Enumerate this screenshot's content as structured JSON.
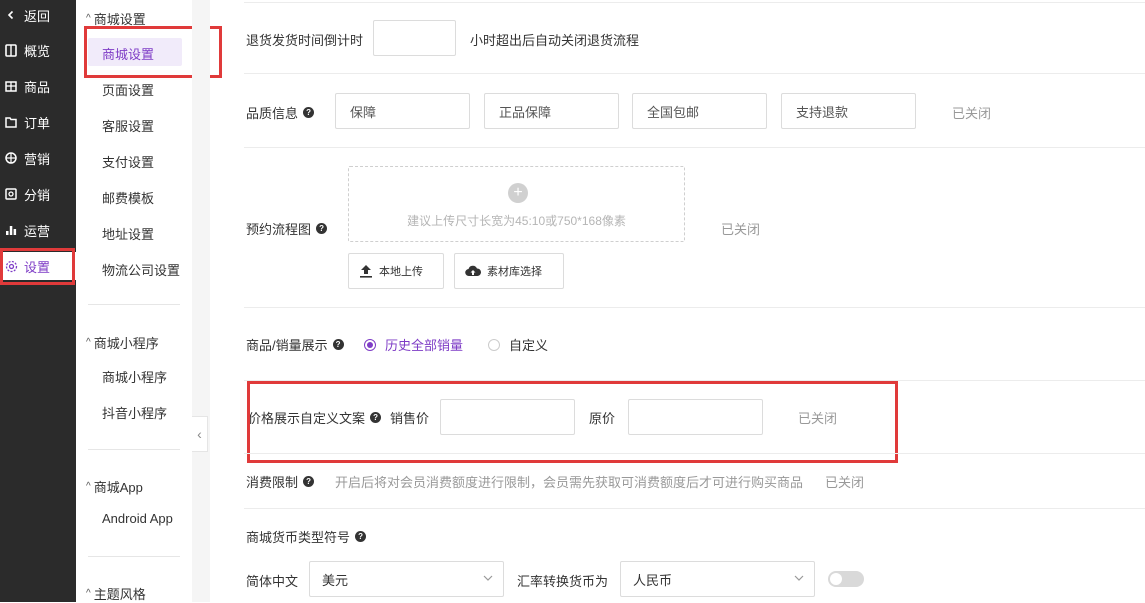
{
  "nav": {
    "back": "返回",
    "items": [
      "概览",
      "商品",
      "订单",
      "营销",
      "分销",
      "运营",
      "设置"
    ]
  },
  "sub": {
    "group_mall": "商城设置",
    "mall_items": [
      "商城设置",
      "页面设置",
      "客服设置",
      "支付设置",
      "邮费模板",
      "地址设置",
      "物流公司设置"
    ],
    "group_mini": "商城小程序",
    "mini_items": [
      "商城小程序",
      "抖音小程序"
    ],
    "group_app": "商城App",
    "app_items": [
      "Android App"
    ],
    "group_theme": "主题风格"
  },
  "main": {
    "return_timer_label": "退货发货时间倒计时",
    "return_timer_value": "",
    "return_timer_suffix": "小时超出后自动关闭退货流程",
    "quality_label": "品质信息",
    "quality_values": [
      "保障",
      "正品保障",
      "全国包邮",
      "支持退款"
    ],
    "quality_status": "已关闭",
    "booking_label": "预约流程图",
    "upload_hint": "建议上传尺寸长宽为45:10或750*168像素",
    "booking_status": "已关闭",
    "local_upload": "本地上传",
    "library_select": "素材库选择",
    "sales_label": "商品/销量展示",
    "sales_options": [
      "历史全部销量",
      "自定义"
    ],
    "price_label": "价格展示自定义文案",
    "price_sale_label": "销售价",
    "price_sale_value": "",
    "price_orig_label": "原价",
    "price_orig_value": "",
    "price_status": "已关闭",
    "consume_label": "消费限制",
    "consume_desc": "开启后将对会员消费额度进行限制，会员需先获取可消费额度后才可进行购买商品",
    "consume_status": "已关闭",
    "currency_label": "商城货币类型符号",
    "currency_lang": "简体中文",
    "currency_value": "美元",
    "convert_label": "汇率转换货币为",
    "convert_value": "人民币"
  },
  "colors": {
    "accent": "#7e3cc6",
    "highlight": "#e03a3a",
    "nav_bg": "#2b2b2b"
  }
}
